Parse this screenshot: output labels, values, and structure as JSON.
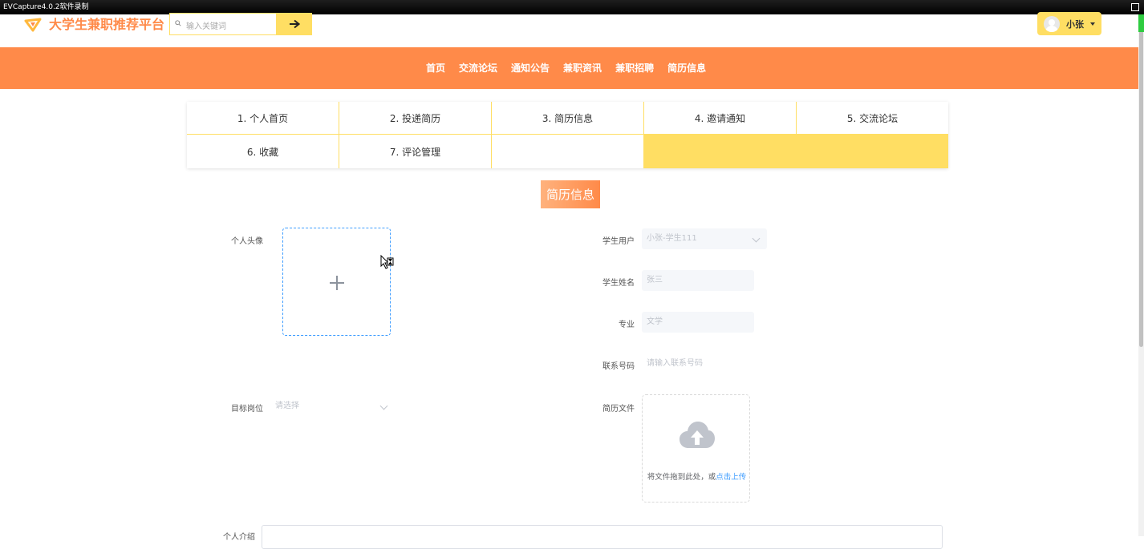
{
  "capture_bar": {
    "title": "EVCapture4.0.2软件录制"
  },
  "header": {
    "site_title": "大学生兼职推荐平台",
    "search_placeholder": "输入关键词",
    "search_button_glyph": "➔",
    "user_name": "小张"
  },
  "nav": {
    "items": [
      "首页",
      "交流论坛",
      "通知公告",
      "兼职资讯",
      "兼职招聘",
      "简历信息"
    ]
  },
  "tabs": [
    "1. 个人首页",
    "2. 投递简历",
    "3. 简历信息",
    "4. 邀请通知",
    "5. 交流论坛",
    "6. 收藏",
    "7. 评论管理"
  ],
  "section_title": "简历信息",
  "form": {
    "avatar_label": "个人头像",
    "student_user_label": "学生用户",
    "student_user_value": "小张-学生111",
    "student_name_label": "学生姓名",
    "student_name_value": "张三",
    "major_label": "专业",
    "major_value": "文学",
    "phone_label": "联系号码",
    "phone_placeholder": "请输入联系号码",
    "target_job_label": "目标岗位",
    "target_job_placeholder": "请选择",
    "resume_file_label": "简历文件",
    "upload_hint": "将文件拖到此处，或",
    "upload_link": "点击上传",
    "intro_label": "个人介绍"
  },
  "colors": {
    "nav": "#ff8a49",
    "accent": "#ffde63",
    "link": "#409eff"
  }
}
